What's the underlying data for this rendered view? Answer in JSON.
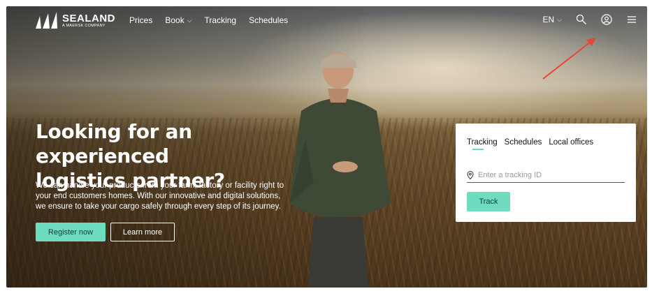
{
  "brand": {
    "name": "SEALAND",
    "tagline": "A MAERSK COMPANY"
  },
  "nav": {
    "links": [
      {
        "label": "Prices",
        "has_dropdown": false
      },
      {
        "label": "Book",
        "has_dropdown": true
      },
      {
        "label": "Tracking",
        "has_dropdown": false
      },
      {
        "label": "Schedules",
        "has_dropdown": false
      }
    ],
    "language": "EN",
    "icons": [
      "search-icon",
      "account-icon",
      "menu-icon"
    ]
  },
  "hero": {
    "title_line1": "Looking for an experienced",
    "title_line2": "logistics partner?",
    "description_line1": "We can handle your products from your farm, factory or facility right to",
    "description_line2": "your end customers homes. With our innovative and digital solutions,",
    "description_line3": "we ensure to take your cargo safely through every step of its journey.",
    "register_label": "Register now",
    "learn_label": "Learn more"
  },
  "tracking_card": {
    "tabs": [
      {
        "label": "Tracking",
        "active": true
      },
      {
        "label": "Schedules",
        "active": false
      },
      {
        "label": "Local offices",
        "active": false
      }
    ],
    "input_placeholder": "Enter a tracking ID",
    "input_value": "",
    "track_label": "Track"
  },
  "colors": {
    "accent": "#6fdcc0",
    "annotation_arrow": "#e8443a",
    "text_on_image": "#ffffff"
  }
}
